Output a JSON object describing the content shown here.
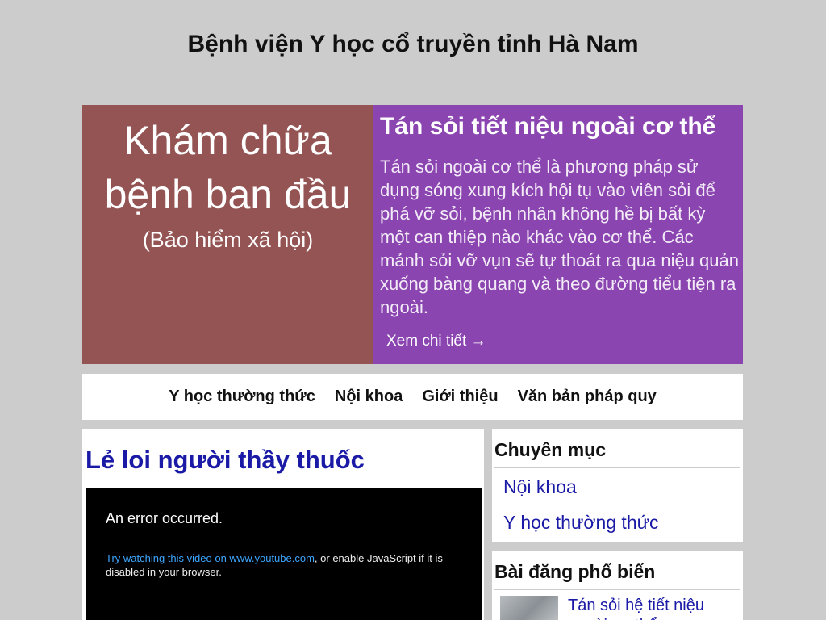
{
  "site": {
    "title": "Bệnh viện Y học cổ truyền tỉnh Hà Nam"
  },
  "hero": {
    "left_title": "Khám chữa bệnh ban đầu",
    "left_subtitle": "(Bảo hiểm xã hội)",
    "right_title": "Tán sỏi tiết niệu ngoài cơ thể",
    "right_body": "Tán sỏi ngoài cơ thể là phương pháp sử dụng sóng xung kích hội tụ vào viên sỏi để phá vỡ sỏi, bệnh nhân không hề bị bất kỳ một can thiệp nào khác vào cơ thể. Các mảnh sỏi vỡ vụn sẽ tự thoát ra qua niệu quản xuống bàng quang và theo đường tiểu tiện ra ngoài.",
    "more_link": "Xem chi tiết →"
  },
  "nav": {
    "items": [
      {
        "label": "Y học thường thức"
      },
      {
        "label": "Nội khoa"
      },
      {
        "label": "Giới thiệu"
      },
      {
        "label": "Văn bản pháp quy"
      }
    ]
  },
  "main": {
    "title": "Lẻ loi người thầy thuốc",
    "video": {
      "error": "An error occurred.",
      "link": "Try watching this video on www.youtube.com",
      "message_rest": ", or enable JavaScript if it is disabled in your browser."
    }
  },
  "sidebar": {
    "categories_title": "Chuyên mục",
    "categories": [
      {
        "label": "Nội khoa"
      },
      {
        "label": "Y học thường thức"
      }
    ],
    "popular_title": "Bài đăng phổ biến",
    "popular": [
      {
        "title": "Tán sỏi hệ tiết niệu ngoài cơ thể"
      }
    ]
  }
}
